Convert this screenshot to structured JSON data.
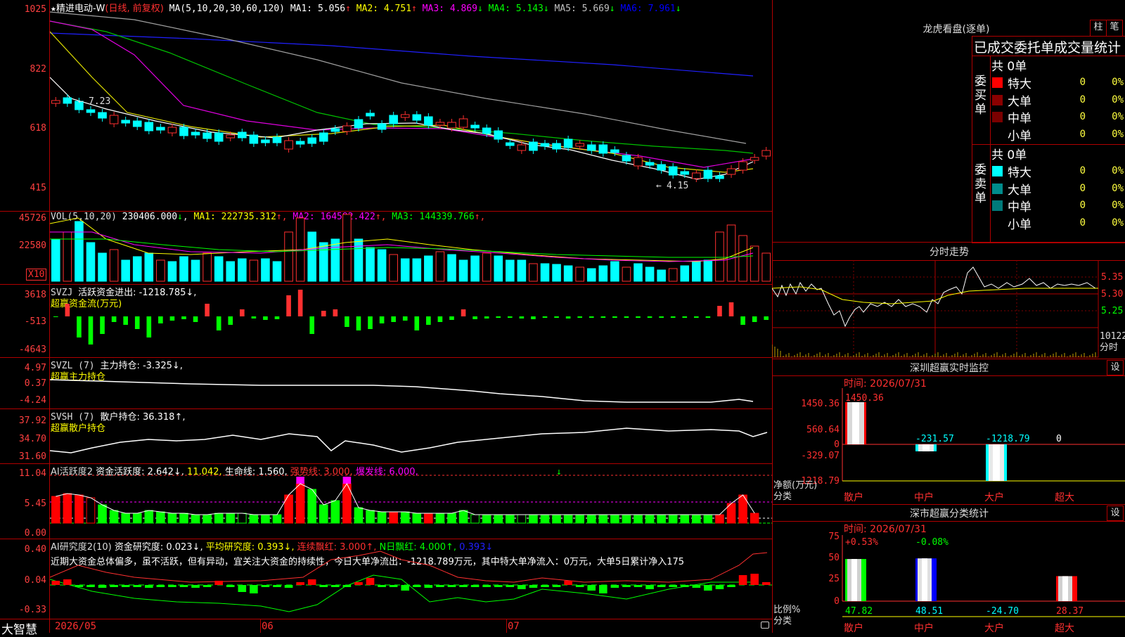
{
  "main": {
    "title_star": "★",
    "title_name": "精进电动-W",
    "title_period": "(日线, 前复权)",
    "ma_label": "MA(5,10,20,30,60,120)",
    "ma": [
      {
        "label": "MA1:",
        "value": "5.056",
        "arrow": "↑",
        "color": "#ffffff"
      },
      {
        "label": "MA2:",
        "value": "4.751",
        "arrow": "↑",
        "color": "#ffff00"
      },
      {
        "label": "MA3:",
        "value": "4.869",
        "arrow": "↓",
        "color": "#ff00ff"
      },
      {
        "label": "MA4:",
        "value": "5.143",
        "arrow": "↓",
        "color": "#00ff00"
      },
      {
        "label": "MA5:",
        "value": "5.669",
        "arrow": "↓",
        "color": "#c0c0c0"
      },
      {
        "label": "MA6:",
        "value": "7.961",
        "arrow": "↓",
        "color": "#0000ff"
      }
    ],
    "y_ticks": [
      "1025",
      "822",
      "618",
      "415"
    ],
    "high_label": "7.23",
    "low_label": "4.15"
  },
  "vol": {
    "label": "VOL(5,10,20)",
    "value": "230406.000",
    "ma": [
      {
        "label": "MA1:",
        "value": "222735.312",
        "arrow": "↑",
        "color": "#ffff00"
      },
      {
        "label": "MA2:",
        "value": "164592.422",
        "arrow": "↑",
        "color": "#ff00ff"
      },
      {
        "label": "MA3:",
        "value": "144339.766",
        "arrow": "↑",
        "color": "#00ff00"
      }
    ],
    "y_ticks": [
      "45726",
      "22580"
    ],
    "unit": "X10"
  },
  "svzj": {
    "label": "SVZJ",
    "title": "活跃资金进出: -1218.785↓,",
    "subtitle": "超赢资金流(万元)",
    "y_ticks": [
      "3618",
      "-513",
      "-4643"
    ]
  },
  "svzl": {
    "label": "SVZL (7)",
    "title": "主力持仓: -3.325↓,",
    "subtitle": "超赢主力持仓",
    "y_ticks": [
      "4.97",
      "0.37",
      "-4.24"
    ]
  },
  "svsh": {
    "label": "SVSH (7)",
    "title": "散户持仓: 36.318↑,",
    "subtitle": "超赢散户持仓",
    "y_ticks": [
      "37.92",
      "34.70",
      "31.60"
    ]
  },
  "ai1": {
    "label": "AI活跃度2",
    "t1": "资金活跃度: 2.642↓,",
    "t2": "11.042,",
    "t3": "生命线: 1.560,",
    "t4": "强势线: 3.000,",
    "t5": "爆发线: 6.000,",
    "y_ticks": [
      "11.04",
      "5.45",
      "0.00"
    ]
  },
  "ai2": {
    "label": "AI研究度2(10)",
    "t1": "资金研究度: 0.023↓,",
    "t2": "平均研究度: 0.393↓,",
    "t3": "连续飘红: 3.000↑,",
    "t4": "N日飘红: 4.000↑,",
    "t5": "0.393↓",
    "comment": "近期大资金总体偏多，虽不活跃，但有异动，宜关注大资金的持续性，今日大单净流出：-1218.789万元，其中特大单净流入：0万元，大单5日累计净入175",
    "y_ticks": [
      "0.40",
      "0.04",
      "-0.33"
    ]
  },
  "x_axis": {
    "brand": "大智慧",
    "labels": [
      "2026/05",
      "06",
      "07"
    ]
  },
  "longhu": {
    "title": "龙虎看盘(逐单)",
    "btn_bar": "柱",
    "btn_pen": "笔",
    "header": "已成交委托单成交量统计",
    "buy_side_label": "委买单",
    "sell_side_label": "委卖单",
    "buy_total": "共 0单",
    "sell_total": "共 0单",
    "buy_rows": [
      {
        "color": "#ff0000",
        "name": "特大",
        "count": "0",
        "pct": "0%"
      },
      {
        "color": "#8b0000",
        "name": "大单",
        "count": "0",
        "pct": "0%"
      },
      {
        "color": "#7a0000",
        "name": "中单",
        "count": "0",
        "pct": "0%"
      },
      {
        "color": "",
        "name": "小单",
        "count": "0",
        "pct": "0%"
      }
    ],
    "sell_rows": [
      {
        "color": "#00ffff",
        "name": "特大",
        "count": "0",
        "pct": "0%"
      },
      {
        "color": "#008b8b",
        "name": "大单",
        "count": "0",
        "pct": "0%"
      },
      {
        "color": "#007a7a",
        "name": "中单",
        "count": "0",
        "pct": "0%"
      },
      {
        "color": "",
        "name": "小单",
        "count": "0",
        "pct": "0%"
      }
    ]
  },
  "intraday": {
    "title": "分时走势",
    "y_ticks": [
      "5.35",
      "5.30",
      "5.25"
    ],
    "vol_label": "10122",
    "vol_unit": "分时"
  },
  "monitor": {
    "title": "深圳超赢实时监控",
    "set_btn": "设",
    "time": "时间: 2026/07/31",
    "y_ticks": [
      "1450.36",
      "560.64",
      "0",
      "-329.07",
      "-1218.79"
    ],
    "y_title1": "净额(万元)",
    "y_title2": "分类",
    "categories": [
      "散户",
      "中户",
      "大户",
      "超大"
    ],
    "values": [
      "1450.36",
      "-231.57",
      "-1218.79",
      "0"
    ]
  },
  "classify": {
    "title": "深市超赢分类统计",
    "set_btn": "设",
    "time": "时间: 2026/07/31",
    "y_ticks": [
      "75",
      "50",
      "25",
      "0"
    ],
    "y_title1": "比例%",
    "y_title2": "分类",
    "categories": [
      "散户",
      "中户",
      "大户",
      "超大"
    ],
    "top_labels": [
      "+0.53%",
      "-0.08%"
    ],
    "bottom_labels": [
      "47.82",
      "48.51",
      "-24.70",
      "28.37"
    ]
  }
}
